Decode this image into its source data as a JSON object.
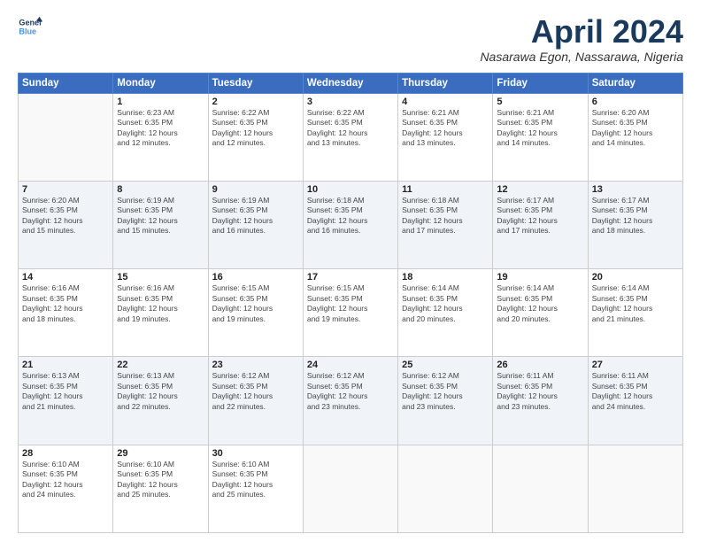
{
  "logo": {
    "line1": "General",
    "line2": "Blue"
  },
  "title": "April 2024",
  "location": "Nasarawa Egon, Nassarawa, Nigeria",
  "days_header": [
    "Sunday",
    "Monday",
    "Tuesday",
    "Wednesday",
    "Thursday",
    "Friday",
    "Saturday"
  ],
  "weeks": [
    [
      {
        "num": "",
        "info": ""
      },
      {
        "num": "1",
        "info": "Sunrise: 6:23 AM\nSunset: 6:35 PM\nDaylight: 12 hours\nand 12 minutes."
      },
      {
        "num": "2",
        "info": "Sunrise: 6:22 AM\nSunset: 6:35 PM\nDaylight: 12 hours\nand 12 minutes."
      },
      {
        "num": "3",
        "info": "Sunrise: 6:22 AM\nSunset: 6:35 PM\nDaylight: 12 hours\nand 13 minutes."
      },
      {
        "num": "4",
        "info": "Sunrise: 6:21 AM\nSunset: 6:35 PM\nDaylight: 12 hours\nand 13 minutes."
      },
      {
        "num": "5",
        "info": "Sunrise: 6:21 AM\nSunset: 6:35 PM\nDaylight: 12 hours\nand 14 minutes."
      },
      {
        "num": "6",
        "info": "Sunrise: 6:20 AM\nSunset: 6:35 PM\nDaylight: 12 hours\nand 14 minutes."
      }
    ],
    [
      {
        "num": "7",
        "info": "Sunrise: 6:20 AM\nSunset: 6:35 PM\nDaylight: 12 hours\nand 15 minutes."
      },
      {
        "num": "8",
        "info": "Sunrise: 6:19 AM\nSunset: 6:35 PM\nDaylight: 12 hours\nand 15 minutes."
      },
      {
        "num": "9",
        "info": "Sunrise: 6:19 AM\nSunset: 6:35 PM\nDaylight: 12 hours\nand 16 minutes."
      },
      {
        "num": "10",
        "info": "Sunrise: 6:18 AM\nSunset: 6:35 PM\nDaylight: 12 hours\nand 16 minutes."
      },
      {
        "num": "11",
        "info": "Sunrise: 6:18 AM\nSunset: 6:35 PM\nDaylight: 12 hours\nand 17 minutes."
      },
      {
        "num": "12",
        "info": "Sunrise: 6:17 AM\nSunset: 6:35 PM\nDaylight: 12 hours\nand 17 minutes."
      },
      {
        "num": "13",
        "info": "Sunrise: 6:17 AM\nSunset: 6:35 PM\nDaylight: 12 hours\nand 18 minutes."
      }
    ],
    [
      {
        "num": "14",
        "info": "Sunrise: 6:16 AM\nSunset: 6:35 PM\nDaylight: 12 hours\nand 18 minutes."
      },
      {
        "num": "15",
        "info": "Sunrise: 6:16 AM\nSunset: 6:35 PM\nDaylight: 12 hours\nand 19 minutes."
      },
      {
        "num": "16",
        "info": "Sunrise: 6:15 AM\nSunset: 6:35 PM\nDaylight: 12 hours\nand 19 minutes."
      },
      {
        "num": "17",
        "info": "Sunrise: 6:15 AM\nSunset: 6:35 PM\nDaylight: 12 hours\nand 19 minutes."
      },
      {
        "num": "18",
        "info": "Sunrise: 6:14 AM\nSunset: 6:35 PM\nDaylight: 12 hours\nand 20 minutes."
      },
      {
        "num": "19",
        "info": "Sunrise: 6:14 AM\nSunset: 6:35 PM\nDaylight: 12 hours\nand 20 minutes."
      },
      {
        "num": "20",
        "info": "Sunrise: 6:14 AM\nSunset: 6:35 PM\nDaylight: 12 hours\nand 21 minutes."
      }
    ],
    [
      {
        "num": "21",
        "info": "Sunrise: 6:13 AM\nSunset: 6:35 PM\nDaylight: 12 hours\nand 21 minutes."
      },
      {
        "num": "22",
        "info": "Sunrise: 6:13 AM\nSunset: 6:35 PM\nDaylight: 12 hours\nand 22 minutes."
      },
      {
        "num": "23",
        "info": "Sunrise: 6:12 AM\nSunset: 6:35 PM\nDaylight: 12 hours\nand 22 minutes."
      },
      {
        "num": "24",
        "info": "Sunrise: 6:12 AM\nSunset: 6:35 PM\nDaylight: 12 hours\nand 23 minutes."
      },
      {
        "num": "25",
        "info": "Sunrise: 6:12 AM\nSunset: 6:35 PM\nDaylight: 12 hours\nand 23 minutes."
      },
      {
        "num": "26",
        "info": "Sunrise: 6:11 AM\nSunset: 6:35 PM\nDaylight: 12 hours\nand 23 minutes."
      },
      {
        "num": "27",
        "info": "Sunrise: 6:11 AM\nSunset: 6:35 PM\nDaylight: 12 hours\nand 24 minutes."
      }
    ],
    [
      {
        "num": "28",
        "info": "Sunrise: 6:10 AM\nSunset: 6:35 PM\nDaylight: 12 hours\nand 24 minutes."
      },
      {
        "num": "29",
        "info": "Sunrise: 6:10 AM\nSunset: 6:35 PM\nDaylight: 12 hours\nand 25 minutes."
      },
      {
        "num": "30",
        "info": "Sunrise: 6:10 AM\nSunset: 6:35 PM\nDaylight: 12 hours\nand 25 minutes."
      },
      {
        "num": "",
        "info": ""
      },
      {
        "num": "",
        "info": ""
      },
      {
        "num": "",
        "info": ""
      },
      {
        "num": "",
        "info": ""
      }
    ]
  ]
}
